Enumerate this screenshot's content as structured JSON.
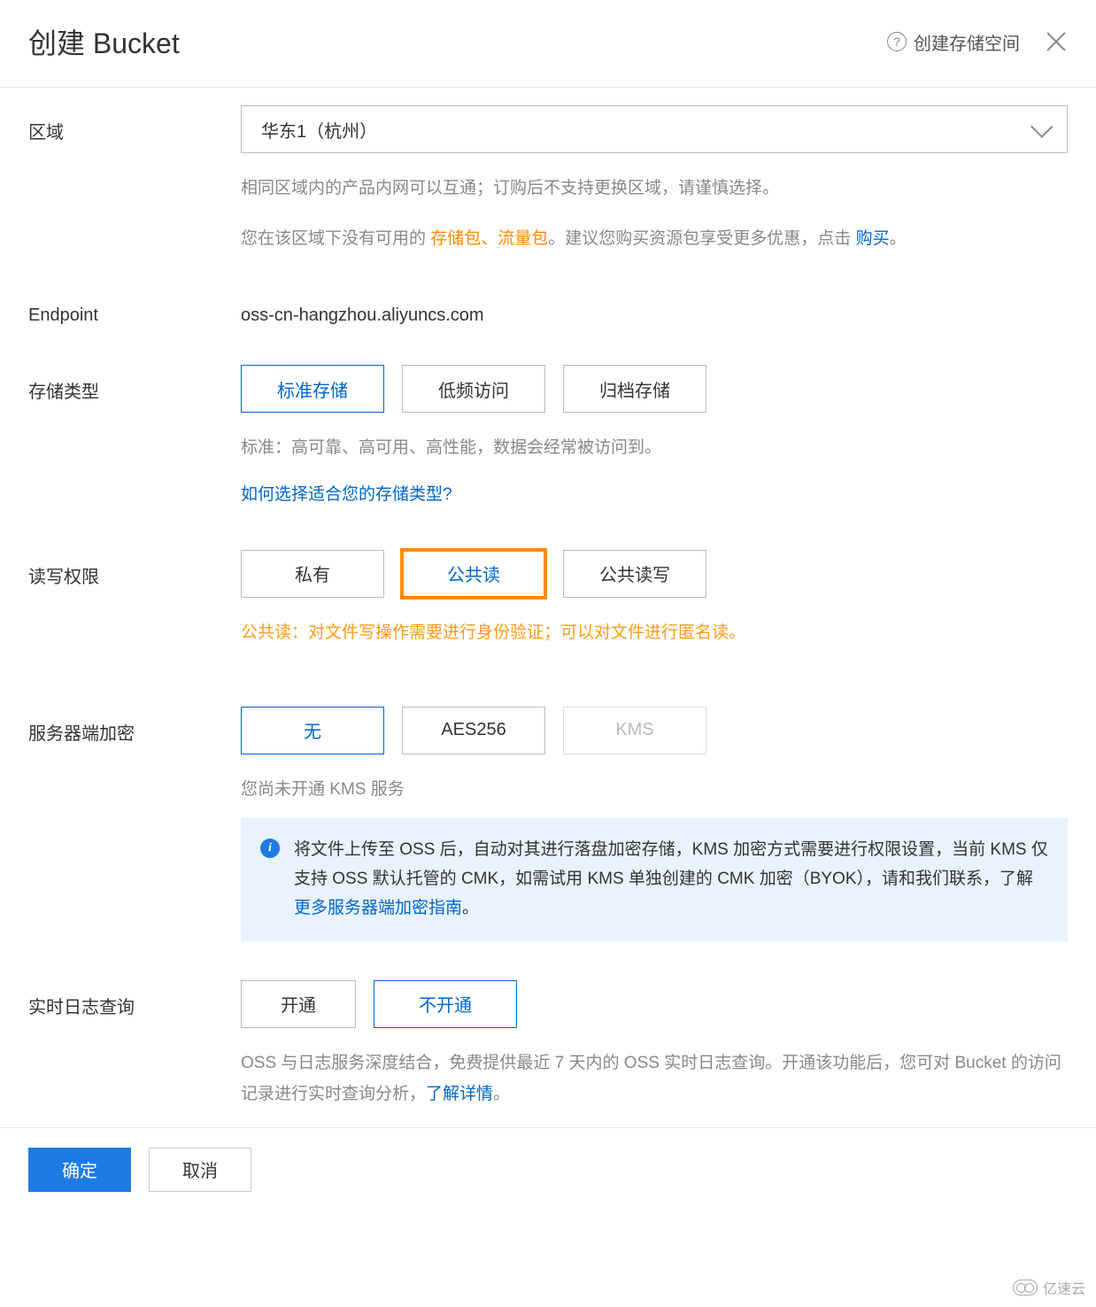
{
  "header": {
    "title": "创建 Bucket",
    "help_label": "创建存储空间"
  },
  "region": {
    "label": "区域",
    "selected": "华东1（杭州）",
    "hint1": "相同区域内的产品内网可以互通；订购后不支持更换区域，请谨慎选择。",
    "hint2_prefix": "您在该区域下没有可用的 ",
    "hint2_orange": "存储包、流量包",
    "hint2_mid": "。建议您购买资源包享受更多优惠，点击 ",
    "hint2_link": "购买",
    "hint2_suffix": "。"
  },
  "endpoint": {
    "label": "Endpoint",
    "value": "oss-cn-hangzhou.aliyuncs.com"
  },
  "storage": {
    "label": "存储类型",
    "options": [
      "标准存储",
      "低频访问",
      "归档存储"
    ],
    "hint": "标准：高可靠、高可用、高性能，数据会经常被访问到。",
    "link": "如何选择适合您的存储类型?"
  },
  "acl": {
    "label": "读写权限",
    "options": [
      "私有",
      "公共读",
      "公共读写"
    ],
    "warn": "公共读：对文件写操作需要进行身份验证；可以对文件进行匿名读。"
  },
  "encryption": {
    "label": "服务器端加密",
    "options": [
      "无",
      "AES256",
      "KMS"
    ],
    "hint": "您尚未开通 KMS 服务",
    "info_prefix": "将文件上传至 OSS 后，自动对其进行落盘加密存储，KMS 加密方式需要进行权限设置，当前 KMS 仅支持 OSS 默认托管的 CMK，如需试用 KMS 单独创建的 CMK 加密（BYOK），请和我们联系，了解 ",
    "info_link": "更多服务器端加密指南",
    "info_suffix": "。"
  },
  "logging": {
    "label": "实时日志查询",
    "options": [
      "开通",
      "不开通"
    ],
    "hint_prefix": "OSS 与日志服务深度结合，免费提供最近 7 天内的 OSS 实时日志查询。开通该功能后，您可对 Bucket 的访问记录进行实时查询分析，",
    "hint_link": "了解详情",
    "hint_suffix": "。"
  },
  "footer": {
    "confirm": "确定",
    "cancel": "取消"
  },
  "watermark": "亿速云"
}
